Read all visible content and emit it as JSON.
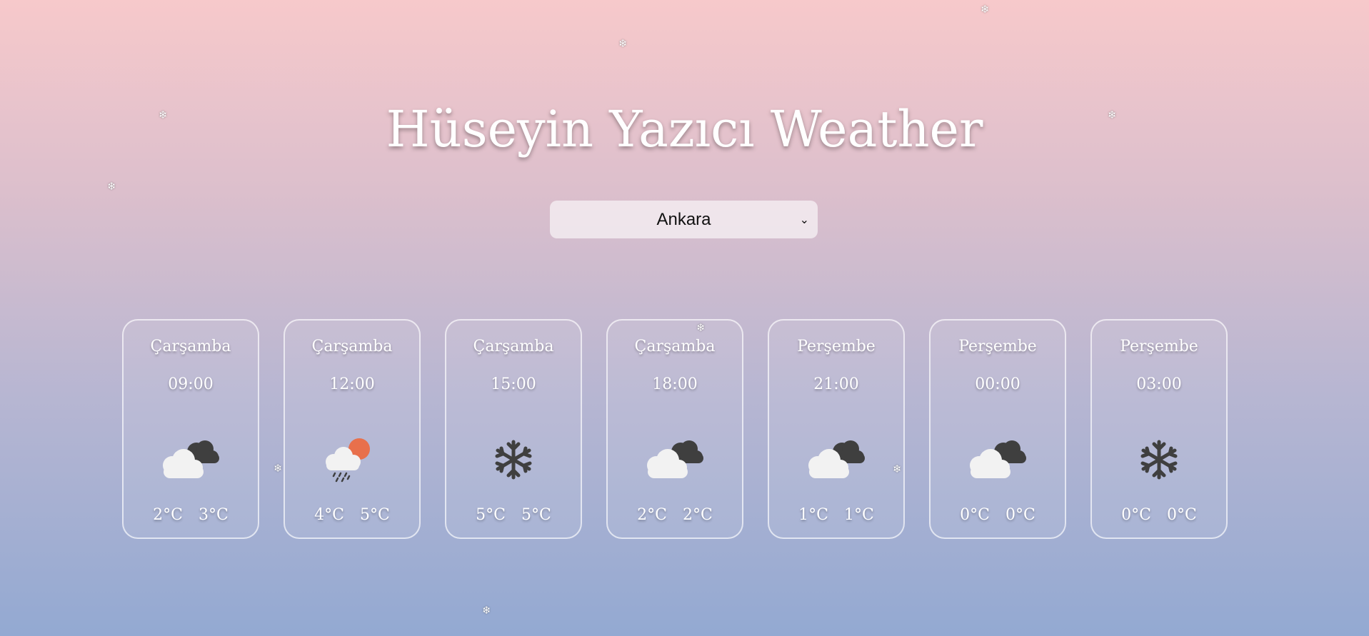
{
  "app": {
    "title": "Hüseyin Yazıcı Weather"
  },
  "city_select": {
    "selected": "Ankara"
  },
  "forecast": [
    {
      "day": "Çarşamba",
      "time": "09:00",
      "icon": "cloudy-icon",
      "min": "2°C",
      "max": "3°C"
    },
    {
      "day": "Çarşamba",
      "time": "12:00",
      "icon": "rain-sun-icon",
      "min": "4°C",
      "max": "5°C"
    },
    {
      "day": "Çarşamba",
      "time": "15:00",
      "icon": "snowflake-icon",
      "min": "5°C",
      "max": "5°C"
    },
    {
      "day": "Çarşamba",
      "time": "18:00",
      "icon": "cloudy-icon",
      "min": "2°C",
      "max": "2°C"
    },
    {
      "day": "Perşembe",
      "time": "21:00",
      "icon": "cloudy-icon",
      "min": "1°C",
      "max": "1°C"
    },
    {
      "day": "Perşembe",
      "time": "00:00",
      "icon": "cloudy-icon",
      "min": "0°C",
      "max": "0°C"
    },
    {
      "day": "Perşembe",
      "time": "03:00",
      "icon": "snowflake-icon",
      "min": "0°C",
      "max": "0°C"
    }
  ],
  "colors": {
    "background_top": "#f7c9cb",
    "background_bottom": "#93a9d2",
    "text": "#ffffff",
    "sun": "#e8704c",
    "dark_cloud": "#3f3f3f",
    "light_cloud": "#f2f2f2"
  },
  "decor": {
    "snowflake_glyph": "❄"
  }
}
